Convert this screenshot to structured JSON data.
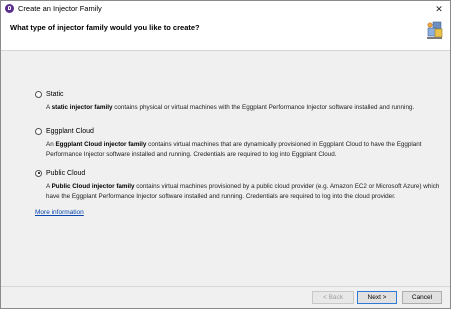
{
  "window": {
    "title": "Create an Injector Family",
    "close_glyph": "✕"
  },
  "header": {
    "question": "What type of injector family would you like to create?"
  },
  "options": [
    {
      "label": "Static",
      "selected": false,
      "desc_prefix": "A ",
      "desc_bold": "static injector family",
      "desc_rest": " contains physical or virtual machines with the Eggplant Performance Injector software installed and running."
    },
    {
      "label": "Eggplant Cloud",
      "selected": false,
      "desc_prefix": "An ",
      "desc_bold": "Eggplant Cloud injector family",
      "desc_rest": " contains virtual machines that are dynamically provisioned in Eggplant Cloud to have the Eggplant Performance Injector software installed and running. Credentials are required to log into Eggplant Cloud."
    },
    {
      "label": "Public Cloud",
      "selected": true,
      "desc_prefix": "A ",
      "desc_bold": "Public Cloud injector family",
      "desc_rest": " contains virtual machines provisioned by a public cloud provider (e.g. Amazon EC2 or Microsoft Azure) which have the Eggplant Performance Injector software installed and running. Credentials are required to log into the cloud provider."
    }
  ],
  "more_info": "More information",
  "buttons": {
    "back": "< Back",
    "next": "Next >",
    "cancel": "Cancel"
  },
  "colors": {
    "link": "#0645ad",
    "app_icon": "#5b2d8e",
    "primary_border": "#2f7bd4"
  }
}
